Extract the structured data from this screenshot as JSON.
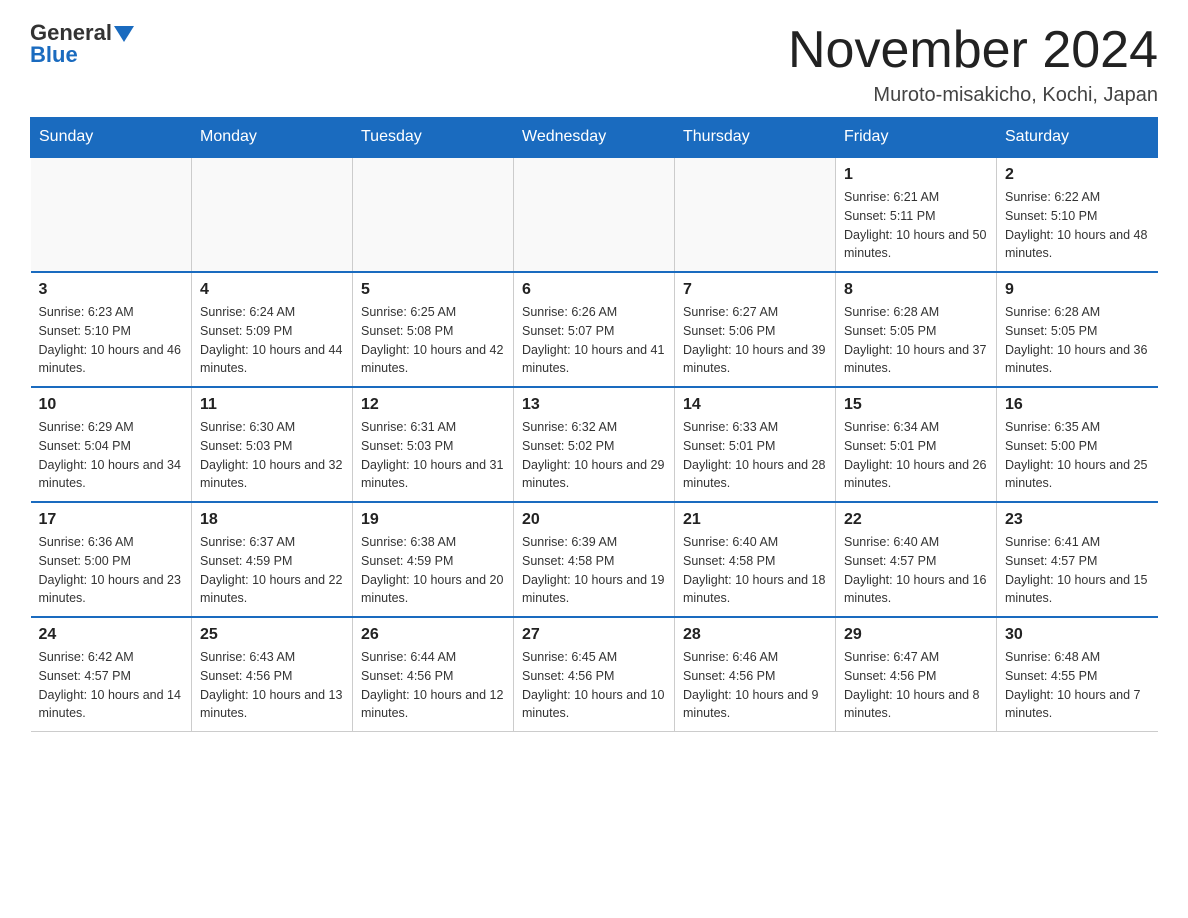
{
  "logo": {
    "general": "General",
    "blue": "Blue"
  },
  "title": "November 2024",
  "subtitle": "Muroto-misakicho, Kochi, Japan",
  "days_of_week": [
    "Sunday",
    "Monday",
    "Tuesday",
    "Wednesday",
    "Thursday",
    "Friday",
    "Saturday"
  ],
  "weeks": [
    [
      {
        "day": "",
        "info": ""
      },
      {
        "day": "",
        "info": ""
      },
      {
        "day": "",
        "info": ""
      },
      {
        "day": "",
        "info": ""
      },
      {
        "day": "",
        "info": ""
      },
      {
        "day": "1",
        "info": "Sunrise: 6:21 AM\nSunset: 5:11 PM\nDaylight: 10 hours and 50 minutes."
      },
      {
        "day": "2",
        "info": "Sunrise: 6:22 AM\nSunset: 5:10 PM\nDaylight: 10 hours and 48 minutes."
      }
    ],
    [
      {
        "day": "3",
        "info": "Sunrise: 6:23 AM\nSunset: 5:10 PM\nDaylight: 10 hours and 46 minutes."
      },
      {
        "day": "4",
        "info": "Sunrise: 6:24 AM\nSunset: 5:09 PM\nDaylight: 10 hours and 44 minutes."
      },
      {
        "day": "5",
        "info": "Sunrise: 6:25 AM\nSunset: 5:08 PM\nDaylight: 10 hours and 42 minutes."
      },
      {
        "day": "6",
        "info": "Sunrise: 6:26 AM\nSunset: 5:07 PM\nDaylight: 10 hours and 41 minutes."
      },
      {
        "day": "7",
        "info": "Sunrise: 6:27 AM\nSunset: 5:06 PM\nDaylight: 10 hours and 39 minutes."
      },
      {
        "day": "8",
        "info": "Sunrise: 6:28 AM\nSunset: 5:05 PM\nDaylight: 10 hours and 37 minutes."
      },
      {
        "day": "9",
        "info": "Sunrise: 6:28 AM\nSunset: 5:05 PM\nDaylight: 10 hours and 36 minutes."
      }
    ],
    [
      {
        "day": "10",
        "info": "Sunrise: 6:29 AM\nSunset: 5:04 PM\nDaylight: 10 hours and 34 minutes."
      },
      {
        "day": "11",
        "info": "Sunrise: 6:30 AM\nSunset: 5:03 PM\nDaylight: 10 hours and 32 minutes."
      },
      {
        "day": "12",
        "info": "Sunrise: 6:31 AM\nSunset: 5:03 PM\nDaylight: 10 hours and 31 minutes."
      },
      {
        "day": "13",
        "info": "Sunrise: 6:32 AM\nSunset: 5:02 PM\nDaylight: 10 hours and 29 minutes."
      },
      {
        "day": "14",
        "info": "Sunrise: 6:33 AM\nSunset: 5:01 PM\nDaylight: 10 hours and 28 minutes."
      },
      {
        "day": "15",
        "info": "Sunrise: 6:34 AM\nSunset: 5:01 PM\nDaylight: 10 hours and 26 minutes."
      },
      {
        "day": "16",
        "info": "Sunrise: 6:35 AM\nSunset: 5:00 PM\nDaylight: 10 hours and 25 minutes."
      }
    ],
    [
      {
        "day": "17",
        "info": "Sunrise: 6:36 AM\nSunset: 5:00 PM\nDaylight: 10 hours and 23 minutes."
      },
      {
        "day": "18",
        "info": "Sunrise: 6:37 AM\nSunset: 4:59 PM\nDaylight: 10 hours and 22 minutes."
      },
      {
        "day": "19",
        "info": "Sunrise: 6:38 AM\nSunset: 4:59 PM\nDaylight: 10 hours and 20 minutes."
      },
      {
        "day": "20",
        "info": "Sunrise: 6:39 AM\nSunset: 4:58 PM\nDaylight: 10 hours and 19 minutes."
      },
      {
        "day": "21",
        "info": "Sunrise: 6:40 AM\nSunset: 4:58 PM\nDaylight: 10 hours and 18 minutes."
      },
      {
        "day": "22",
        "info": "Sunrise: 6:40 AM\nSunset: 4:57 PM\nDaylight: 10 hours and 16 minutes."
      },
      {
        "day": "23",
        "info": "Sunrise: 6:41 AM\nSunset: 4:57 PM\nDaylight: 10 hours and 15 minutes."
      }
    ],
    [
      {
        "day": "24",
        "info": "Sunrise: 6:42 AM\nSunset: 4:57 PM\nDaylight: 10 hours and 14 minutes."
      },
      {
        "day": "25",
        "info": "Sunrise: 6:43 AM\nSunset: 4:56 PM\nDaylight: 10 hours and 13 minutes."
      },
      {
        "day": "26",
        "info": "Sunrise: 6:44 AM\nSunset: 4:56 PM\nDaylight: 10 hours and 12 minutes."
      },
      {
        "day": "27",
        "info": "Sunrise: 6:45 AM\nSunset: 4:56 PM\nDaylight: 10 hours and 10 minutes."
      },
      {
        "day": "28",
        "info": "Sunrise: 6:46 AM\nSunset: 4:56 PM\nDaylight: 10 hours and 9 minutes."
      },
      {
        "day": "29",
        "info": "Sunrise: 6:47 AM\nSunset: 4:56 PM\nDaylight: 10 hours and 8 minutes."
      },
      {
        "day": "30",
        "info": "Sunrise: 6:48 AM\nSunset: 4:55 PM\nDaylight: 10 hours and 7 minutes."
      }
    ]
  ]
}
